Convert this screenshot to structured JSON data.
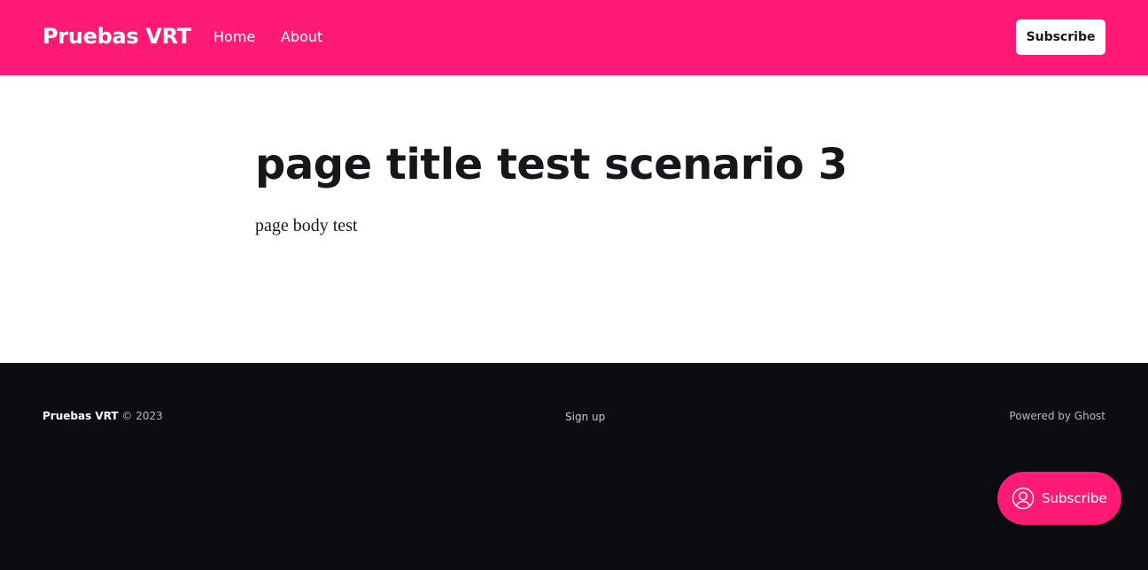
{
  "colors": {
    "accent": "#ff1a75",
    "footer_bg": "#0c0d10",
    "text_dark": "#15171a"
  },
  "header": {
    "site_title": "Pruebas VRT",
    "nav": [
      {
        "label": "Home"
      },
      {
        "label": "About"
      }
    ],
    "subscribe_label": "Subscribe"
  },
  "main": {
    "title": "page title test scenario 3",
    "body": "page body test"
  },
  "footer": {
    "site_name": "Pruebas VRT",
    "copyright": "© 2023",
    "signup_label": "Sign up",
    "powered_by": "Powered by Ghost"
  },
  "portal": {
    "label": "Subscribe",
    "icon": "user-circle-icon"
  }
}
